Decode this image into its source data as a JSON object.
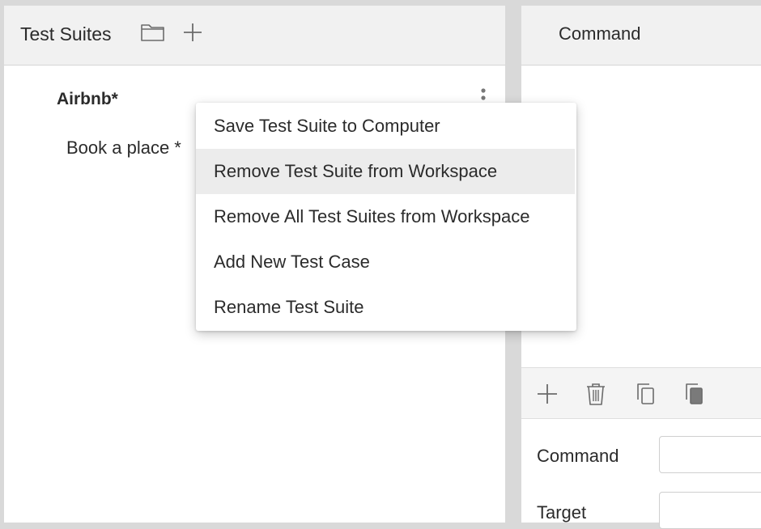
{
  "test_suites_panel": {
    "title": "Test Suites",
    "icons": {
      "open": "folder-icon",
      "add": "plus-icon",
      "more": "kebab-icon"
    },
    "suite": {
      "name": "Airbnb*"
    },
    "test_case": {
      "name": "Book a place *"
    }
  },
  "context_menu": {
    "items": [
      {
        "label": "Save Test Suite to Computer"
      },
      {
        "label": "Remove Test Suite from Workspace",
        "highlighted": true
      },
      {
        "label": "Remove All Test Suites from Workspace"
      },
      {
        "label": "Add New Test Case"
      },
      {
        "label": "Rename Test Suite"
      }
    ]
  },
  "command_panel": {
    "header": "Command",
    "toolbar_icons": [
      "plus-icon",
      "trash-icon",
      "copy-icon",
      "paste-icon"
    ],
    "fields": {
      "command": {
        "label": "Command",
        "value": ""
      },
      "target": {
        "label": "Target",
        "value": ""
      }
    }
  },
  "colors": {
    "background": "#d9d9d9",
    "panel": "#ffffff",
    "header": "#f1f1f1",
    "menu_highlight": "#ececec",
    "icon": "#666666"
  }
}
